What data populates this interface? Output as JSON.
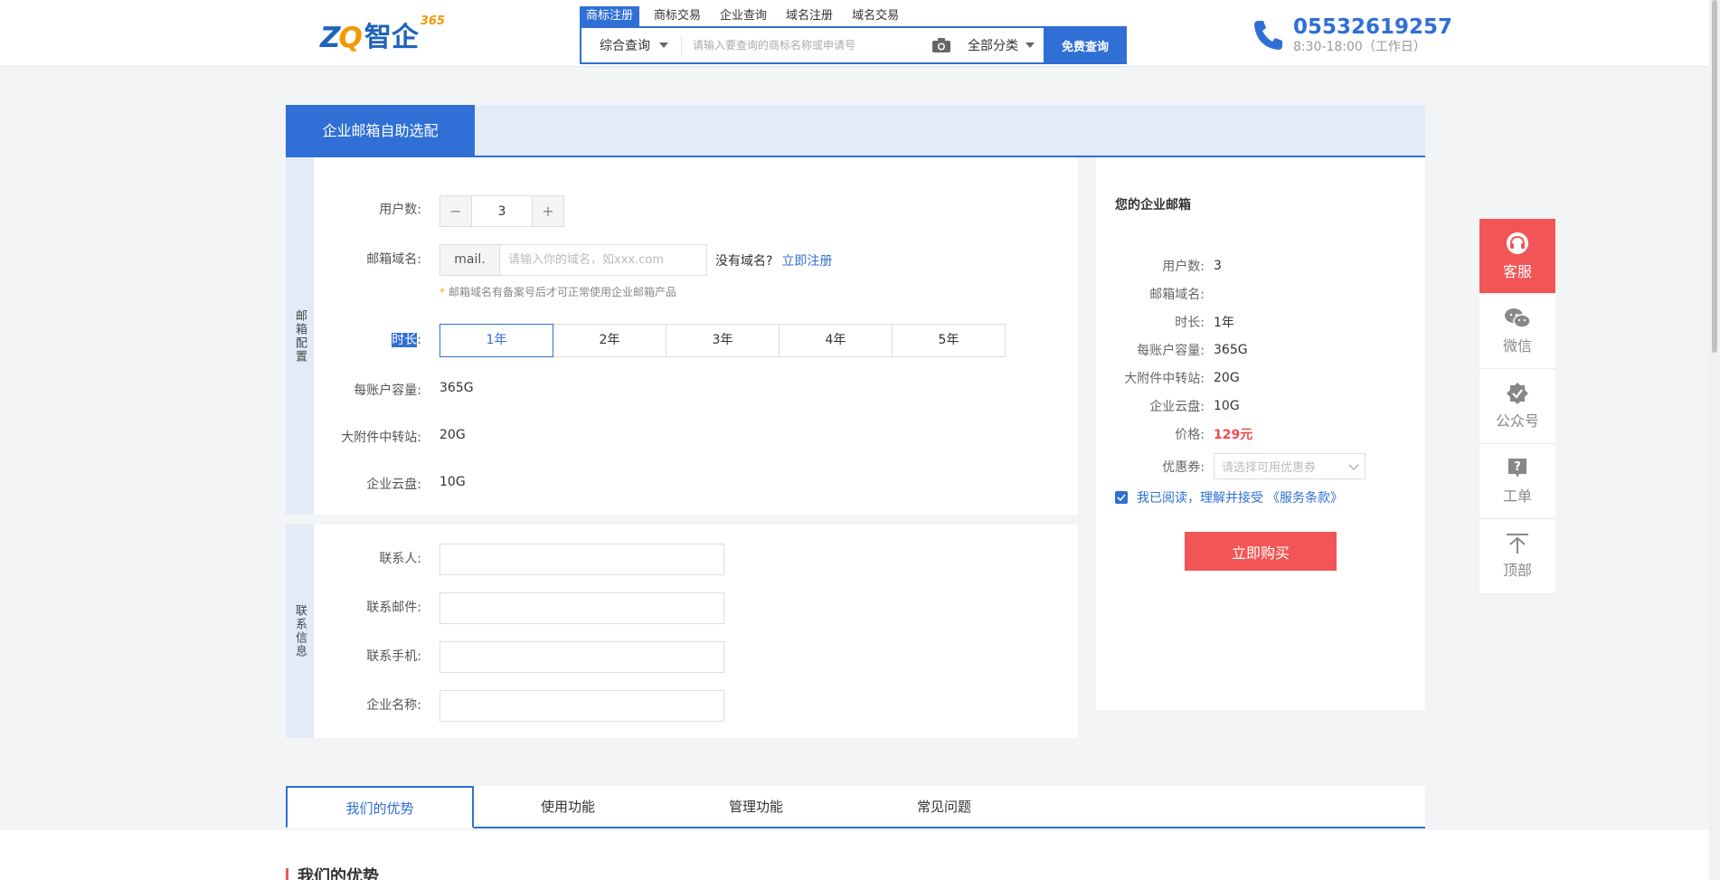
{
  "header": {
    "logo": {
      "mark_left": "Z",
      "mark_right": "Q",
      "text": "智企",
      "sup": "365"
    },
    "search_tabs": [
      "商标注册",
      "商标交易",
      "企业查询",
      "域名注册",
      "域名交易"
    ],
    "search_type": "综合查询",
    "search_placeholder": "请输入要查询的商标名称或申请号",
    "search_category": "全部分类",
    "search_button": "免费查询",
    "phone_number": "05532619257",
    "phone_hours": "8:30-18:00（工作日）"
  },
  "page_tab": "企业邮箱自助选配",
  "config": {
    "side_label": "邮箱配置",
    "users_label": "用户数:",
    "users_minus": "−",
    "users_value": "3",
    "users_plus": "+",
    "domain_label": "邮箱域名:",
    "domain_prefix": "mail.",
    "domain_placeholder": "请输入你的域名，如xxx.com",
    "no_domain": "没有域名?",
    "register_link": "立即注册",
    "hint_star": "*",
    "hint": "邮箱域名有备案号后才可正常使用企业邮箱产品",
    "duration_label": "时长",
    "duration_colon": ":",
    "durations": [
      "1年",
      "2年",
      "3年",
      "4年",
      "5年"
    ],
    "capacity_label": "每账户容量:",
    "capacity_value": "365G",
    "attachment_label": "大附件中转站:",
    "attachment_value": "20G",
    "cloud_label": "企业云盘:",
    "cloud_value": "10G"
  },
  "contact": {
    "side_label": "联系信息",
    "name_label": "联系人:",
    "email_label": "联系邮件:",
    "mobile_label": "联系手机:",
    "company_label": "企业名称:"
  },
  "summary": {
    "title": "您的企业邮箱",
    "users_label": "用户数:",
    "users_value": "3",
    "domain_label": "邮箱域名:",
    "duration_label": "时长:",
    "duration_value": "1年",
    "capacity_label": "每账户容量:",
    "capacity_value": "365G",
    "attachment_label": "大附件中转站:",
    "attachment_value": "20G",
    "cloud_label": "企业云盘:",
    "cloud_value": "10G",
    "price_label": "价格:",
    "price_value": "129元",
    "coupon_label": "优惠券:",
    "coupon_placeholder": "请选择可用优惠券",
    "agree_text": "我已阅读，理解并接受",
    "terms_link": "《服务条款》",
    "buy_button": "立即购买"
  },
  "float_bar": [
    {
      "label": "客服",
      "icon": "headset-icon"
    },
    {
      "label": "微信",
      "icon": "wechat-icon"
    },
    {
      "label": "公众号",
      "icon": "verified-icon"
    },
    {
      "label": "工单",
      "icon": "question-icon"
    },
    {
      "label": "顶部",
      "icon": "arrow-up-icon"
    }
  ],
  "bottom_tabs": [
    "我们的优势",
    "使用功能",
    "管理功能",
    "常见问题"
  ],
  "advantages_title": "我们的优势",
  "colors": {
    "primary": "#2f6fd6",
    "danger": "#f25555",
    "price": "#f04b4b",
    "banner": "#e3ebf9"
  }
}
